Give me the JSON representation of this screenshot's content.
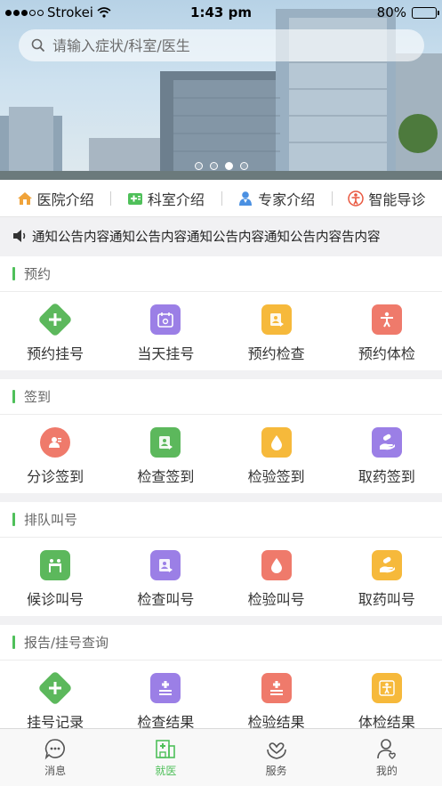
{
  "status_bar": {
    "carrier": "Strokei",
    "time": "1:43 pm",
    "battery": "80%",
    "battery_level": 0.8
  },
  "search": {
    "placeholder": "请输入症状/科室/医生"
  },
  "banner": {
    "page_count": 4,
    "active_page": 2
  },
  "quick_nav": [
    {
      "label": "医院介绍",
      "icon": "house-icon",
      "color": "#f0a33a"
    },
    {
      "label": "科室介绍",
      "icon": "medical-kit-icon",
      "color": "#4fc05a"
    },
    {
      "label": "专家介绍",
      "icon": "doctor-icon",
      "color": "#4a90e2"
    },
    {
      "label": "智能导诊",
      "icon": "body-guide-icon",
      "color": "#e9573f"
    }
  ],
  "notice": {
    "text": "通知公告内容通知公告内容通知公告内容通知公告内容告内容",
    "icon": "speaker-icon"
  },
  "sections": [
    {
      "title": "预约",
      "items": [
        {
          "label": "预约挂号",
          "icon": "plus-diamond-icon",
          "color": "#5cb85c"
        },
        {
          "label": "当天挂号",
          "icon": "calendar-icon",
          "color": "#9b7fe6"
        },
        {
          "label": "预约检查",
          "icon": "report-icon",
          "color": "#f6b93b"
        },
        {
          "label": "预约体检",
          "icon": "person-icon",
          "color": "#ef7a6b"
        }
      ]
    },
    {
      "title": "签到",
      "items": [
        {
          "label": "分诊签到",
          "icon": "user-id-icon",
          "color": "#ef7a6b"
        },
        {
          "label": "检查签到",
          "icon": "report-icon",
          "color": "#5cb85c"
        },
        {
          "label": "检验签到",
          "icon": "drop-icon",
          "color": "#f6b93b"
        },
        {
          "label": "取药签到",
          "icon": "hand-pill-icon",
          "color": "#9b7fe6"
        }
      ]
    },
    {
      "title": "排队叫号",
      "items": [
        {
          "label": "候诊叫号",
          "icon": "waiting-icon",
          "color": "#5cb85c"
        },
        {
          "label": "检查叫号",
          "icon": "report-icon",
          "color": "#9b7fe6"
        },
        {
          "label": "检验叫号",
          "icon": "drop-icon",
          "color": "#ef7a6b"
        },
        {
          "label": "取药叫号",
          "icon": "hand-pill-icon",
          "color": "#f6b93b"
        }
      ]
    },
    {
      "title": "报告/挂号查询",
      "items": [
        {
          "label": "挂号记录",
          "icon": "plus-diamond-icon",
          "color": "#5cb85c"
        },
        {
          "label": "检查结果",
          "icon": "list-icon",
          "color": "#9b7fe6"
        },
        {
          "label": "检验结果",
          "icon": "list-icon",
          "color": "#ef7a6b"
        },
        {
          "label": "体检结果",
          "icon": "checkup-icon",
          "color": "#f6b93b"
        }
      ]
    }
  ],
  "tab_bar": [
    {
      "label": "消息",
      "icon": "chat-icon",
      "active": false
    },
    {
      "label": "就医",
      "icon": "hospital-icon",
      "active": true
    },
    {
      "label": "服务",
      "icon": "heart-hands-icon",
      "active": false
    },
    {
      "label": "我的",
      "icon": "profile-icon",
      "active": false
    }
  ],
  "colors": {
    "accent": "#4fc05a",
    "background": "#f1f1f3"
  }
}
